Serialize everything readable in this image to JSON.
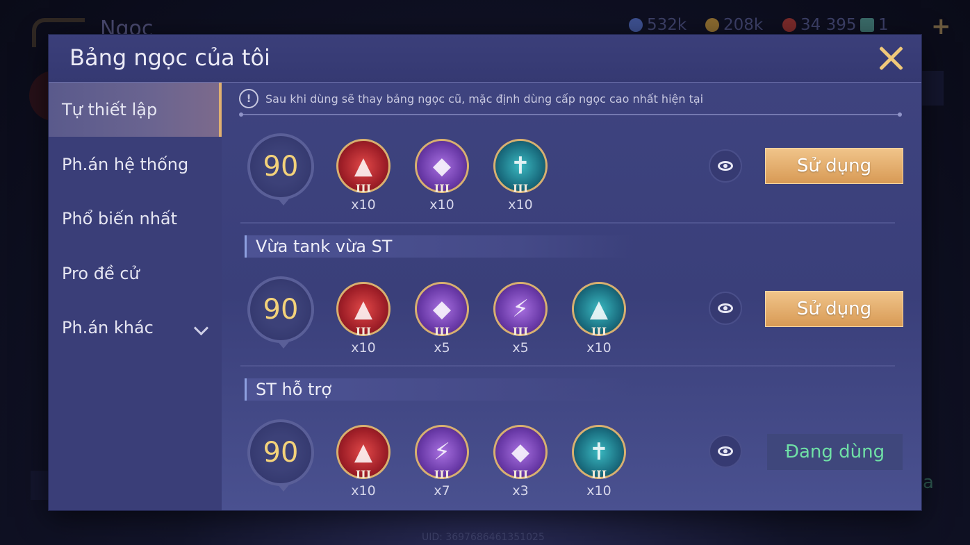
{
  "background": {
    "screen_title": "Ngọc",
    "resources": [
      {
        "value": "532k",
        "icon": "blue-coin-icon",
        "color": "#3d5090"
      },
      {
        "value": "208k",
        "icon": "gold-coin-icon",
        "color": "#8a6a30"
      },
      {
        "value": "34 395",
        "icon": "red-gem-icon",
        "color": "#7a2a2a"
      },
      {
        "value": "1",
        "icon": "card-icon",
        "color": "#3a6a68"
      }
    ],
    "uid": "UID: 3697686461351025",
    "partial_text_right": "a"
  },
  "modal": {
    "title": "Bảng ngọc của tôi",
    "notice": "Sau khi dùng sẽ thay bảng ngọc cũ, mặc định dùng cấp ngọc cao nhất hiện tại",
    "sidebar": [
      {
        "label": "Tự thiết lập",
        "active": true
      },
      {
        "label": "Ph.án hệ thống",
        "active": false
      },
      {
        "label": "Phổ biến nhất",
        "active": false
      },
      {
        "label": "Pro đề cử",
        "active": false
      },
      {
        "label": "Ph.án khác",
        "active": false,
        "has_dropdown": true
      }
    ],
    "rune_sets": [
      {
        "name": "",
        "level": "90",
        "runes": [
          {
            "color": "red",
            "tier": "III",
            "qty": "x10",
            "icon": "red-rune-icon"
          },
          {
            "color": "purple",
            "tier": "III",
            "qty": "x10",
            "icon": "purple-rune-icon"
          },
          {
            "color": "teal",
            "tier": "III",
            "qty": "x10",
            "icon": "teal-rune-icon"
          }
        ],
        "action": "Sử dụng",
        "in_use": false
      },
      {
        "name": "Vừa tank vừa ST",
        "level": "90",
        "runes": [
          {
            "color": "red",
            "tier": "III",
            "qty": "x10",
            "icon": "red-rune-icon"
          },
          {
            "color": "purple",
            "tier": "III",
            "qty": "x5",
            "icon": "purple-rune-icon"
          },
          {
            "color": "purple",
            "tier": "III",
            "qty": "x5",
            "icon": "purple-lightning-rune-icon"
          },
          {
            "color": "teal",
            "tier": "III",
            "qty": "x10",
            "icon": "teal-rune-icon"
          }
        ],
        "action": "Sử dụng",
        "in_use": false
      },
      {
        "name": "ST hỗ trợ",
        "level": "90",
        "runes": [
          {
            "color": "red",
            "tier": "III",
            "qty": "x10",
            "icon": "red-rune-icon"
          },
          {
            "color": "purple",
            "tier": "III",
            "qty": "x7",
            "icon": "purple-lightning-rune-icon"
          },
          {
            "color": "purple",
            "tier": "III",
            "qty": "x3",
            "icon": "purple-rune-icon"
          },
          {
            "color": "teal",
            "tier": "III",
            "qty": "x10",
            "icon": "teal-rune-icon"
          }
        ],
        "action": "Đang dùng",
        "in_use": true
      }
    ],
    "colors": {
      "accent_gold": "#e0b070",
      "in_use_green": "#6fe0a6",
      "level_gold": "#f3d27a"
    }
  }
}
